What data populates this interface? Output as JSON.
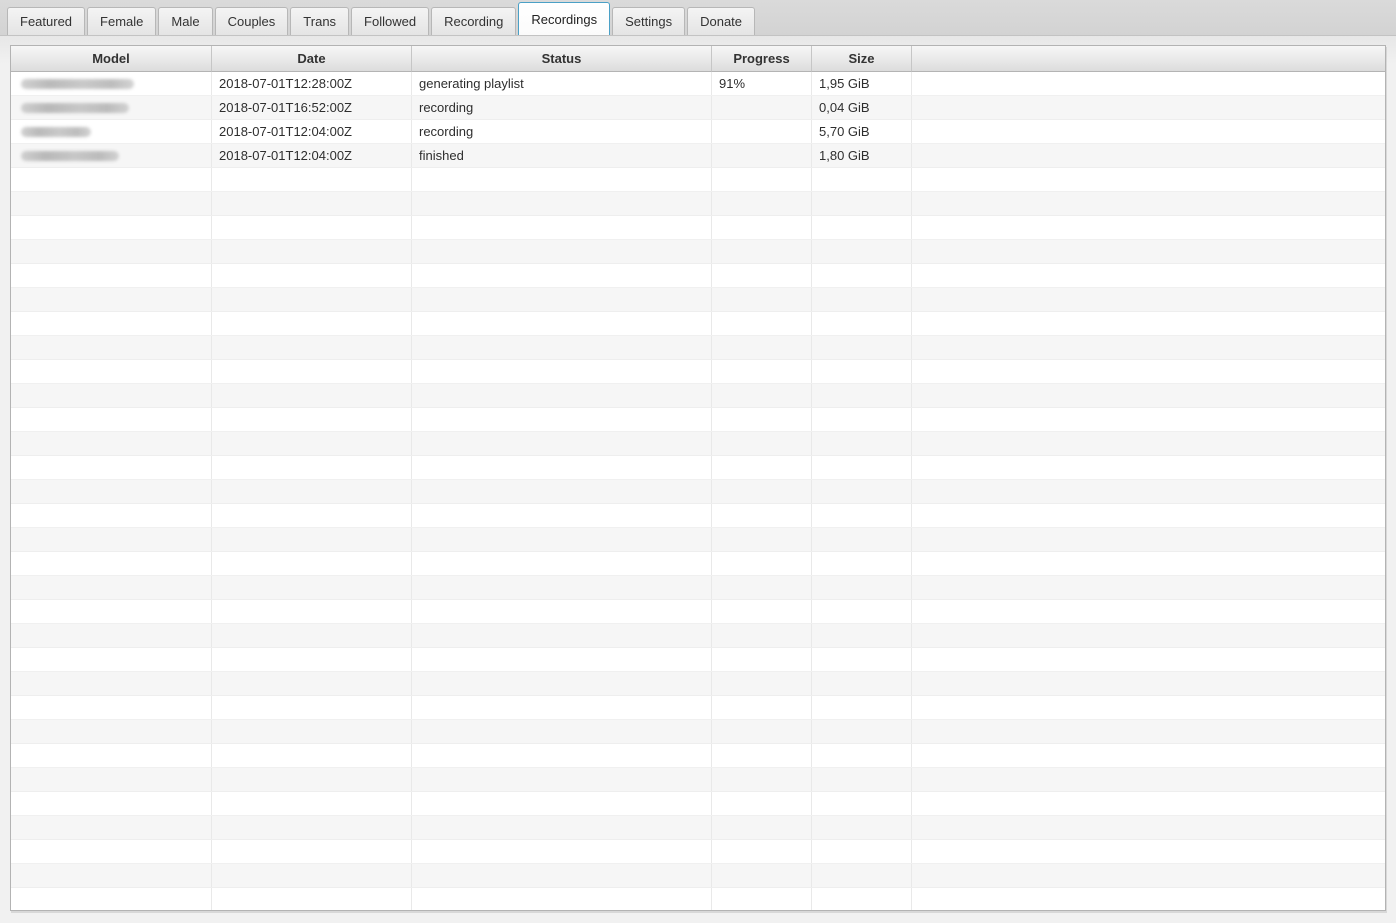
{
  "tabs": [
    {
      "label": "Featured",
      "active": false
    },
    {
      "label": "Female",
      "active": false
    },
    {
      "label": "Male",
      "active": false
    },
    {
      "label": "Couples",
      "active": false
    },
    {
      "label": "Trans",
      "active": false
    },
    {
      "label": "Followed",
      "active": false
    },
    {
      "label": "Recording",
      "active": false
    },
    {
      "label": "Recordings",
      "active": true
    },
    {
      "label": "Settings",
      "active": false
    },
    {
      "label": "Donate",
      "active": false
    }
  ],
  "table": {
    "columns": [
      "Model",
      "Date",
      "Status",
      "Progress",
      "Size",
      ""
    ],
    "rows": [
      {
        "model_redacted": true,
        "model_blur_width": 113,
        "date": "2018-07-01T12:28:00Z",
        "status": "generating playlist",
        "progress": "91%",
        "size": "1,95 GiB"
      },
      {
        "model_redacted": true,
        "model_blur_width": 108,
        "date": "2018-07-01T16:52:00Z",
        "status": "recording",
        "progress": "",
        "size": "0,04 GiB"
      },
      {
        "model_redacted": true,
        "model_blur_width": 70,
        "date": "2018-07-01T12:04:00Z",
        "status": "recording",
        "progress": "",
        "size": "5,70 GiB"
      },
      {
        "model_redacted": true,
        "model_blur_width": 98,
        "date": "2018-07-01T12:04:00Z",
        "status": "finished",
        "progress": "",
        "size": "1,80 GiB"
      }
    ],
    "empty_row_count": 31
  },
  "colors": {
    "accent_tab_border": "#4aa0c6",
    "row_alt_background": "#f6f6f6",
    "header_text": "#333333"
  }
}
